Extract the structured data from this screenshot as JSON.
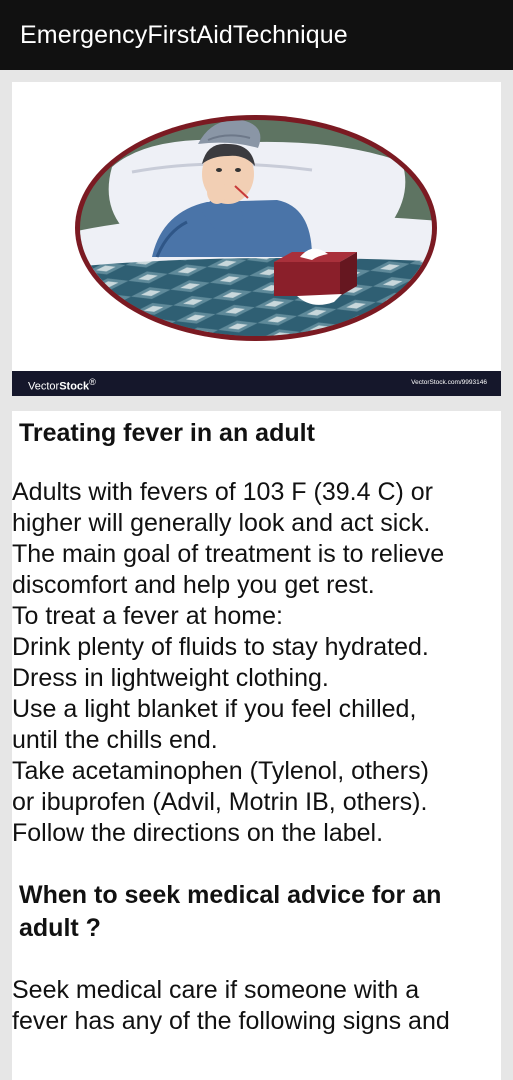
{
  "app_bar": {
    "title": "EmergencyFirstAidTechnique"
  },
  "illustration": {
    "icon": "sick-man-with-fever-illustration",
    "watermark_brand": "VectorStock",
    "watermark_brand_a": "Vector",
    "watermark_brand_b": "Stock",
    "watermark_registered": "®",
    "watermark_url": "VectorStock.com/9993146"
  },
  "article": {
    "heading": "Treating fever in an adult",
    "intro_lines": [
      " Adults with fevers of 103 F (39.4 C) or",
      "higher will generally look and act sick.",
      "The main goal of treatment is to relieve",
      "discomfort and help you get rest."
    ],
    "home_lines": [
      " To treat a fever at home:",
      " Drink plenty of fluids to stay hydrated.",
      " Dress in lightweight clothing.",
      " Use a light blanket if you feel chilled,",
      "until the chills end.",
      " Take acetaminophen (Tylenol, others)",
      "or ibuprofen (Advil, Motrin IB, others).",
      "Follow the directions on the label."
    ],
    "heading_2_line1": "When to seek medical advice for an",
    "heading_2_line2": "adult ?",
    "seek_lines": [
      " Seek medical care if someone with a",
      "fever has any of the following signs and"
    ]
  },
  "colors": {
    "app_bar_bg": "#111111",
    "page_bg": "#e6e6e6",
    "watermark_bg": "#15172b",
    "oval_border": "#7b1a22",
    "pajama_blue": "#4a74a8"
  }
}
